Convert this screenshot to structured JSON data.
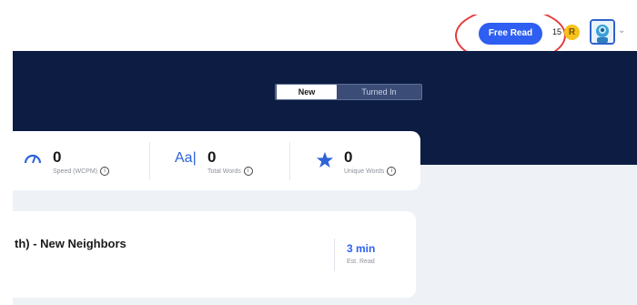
{
  "header": {
    "free_read_label": "Free Read",
    "coin_count": "15",
    "coin_letter": "R"
  },
  "hero": {
    "tabs": [
      {
        "label": "New",
        "selected": true
      },
      {
        "label": "Turned In",
        "selected": false
      }
    ]
  },
  "stats": [
    {
      "value": "0",
      "label": "Speed (WCPM)",
      "icon": "speedometer-icon"
    },
    {
      "value": "0",
      "label": "Total Words",
      "icon": "text-size-icon",
      "icon_text": "Aa|"
    },
    {
      "value": "0",
      "label": "Unique Words",
      "icon": "star-icon"
    }
  ],
  "book": {
    "title": "th) - New Neighbors",
    "read_time": "3 min",
    "read_time_label": "Est. Read"
  },
  "colors": {
    "accent": "#2f5ff2",
    "hero_bg": "#0c1c42",
    "highlight": "#e63a3a",
    "coin": "#f7c21b"
  }
}
